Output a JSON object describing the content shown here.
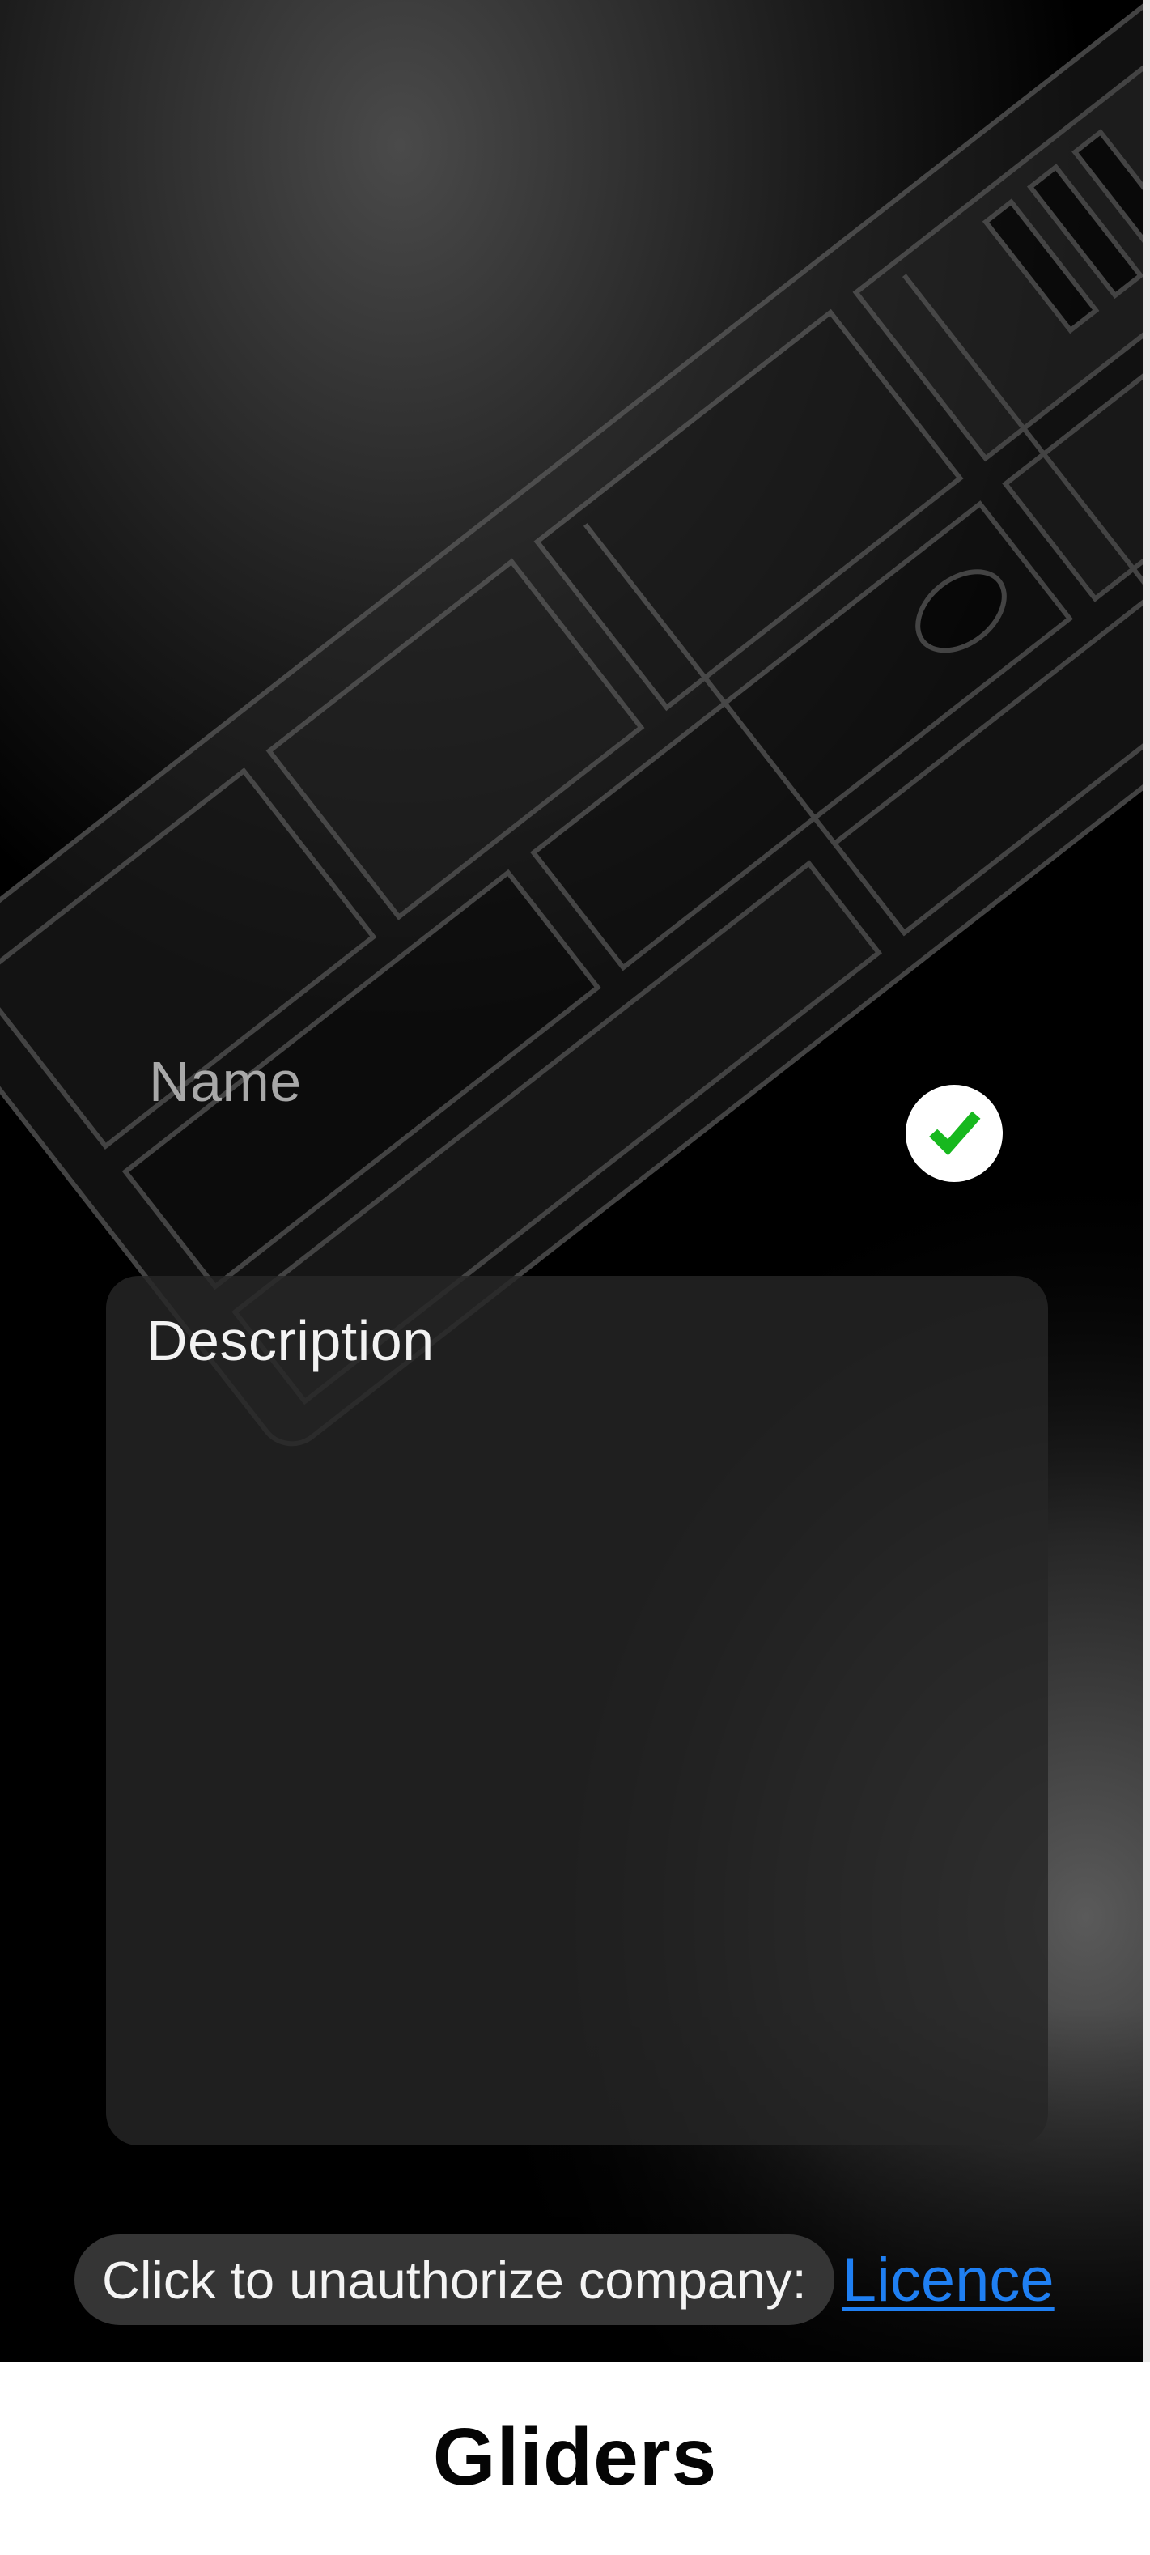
{
  "form": {
    "name_placeholder": "Name",
    "name_value": "",
    "name_status_icon": "check-icon",
    "description_placeholder": "Description",
    "description_value": ""
  },
  "auth": {
    "prompt": "Click to unauthorize company:",
    "link_label": "Licence"
  },
  "footer": {
    "title": "Gliders"
  },
  "colors": {
    "background": "#000000",
    "check_green": "#17b81e",
    "link_blue": "#1f7ff2",
    "pill_bg": "#353535",
    "footer_bg": "#ffffff"
  }
}
